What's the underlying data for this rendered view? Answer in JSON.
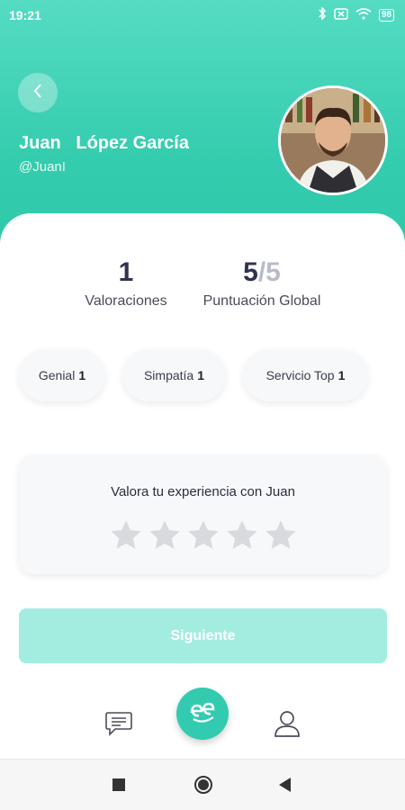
{
  "status_bar": {
    "time": "19:21",
    "battery": "98",
    "icons": [
      "bluetooth-icon",
      "sim-off-icon",
      "wifi-icon",
      "battery-icon"
    ]
  },
  "profile": {
    "first_name": "Juan",
    "last_name": "López García",
    "name_display": "Juan   López García",
    "handle": "@JuanI"
  },
  "stats": {
    "ratings_count": "1",
    "ratings_label": "Valoraciones",
    "score": "5",
    "score_max": "5",
    "score_label": "Puntuación Global"
  },
  "badges": [
    {
      "label": "Genial",
      "count": "1"
    },
    {
      "label": "Simpatía",
      "count": "1"
    },
    {
      "label": "Servicio Top",
      "count": "1"
    }
  ],
  "rating": {
    "prompt": "Valora tu experiencia con Juan",
    "stars_total": 5,
    "stars_selected": 0
  },
  "actions": {
    "next_label": "Siguiente"
  },
  "colors": {
    "accent": "#34ccae",
    "button_disabled": "#a3ede0",
    "star_empty": "#d8dade"
  },
  "nav": {
    "items": [
      "chat-icon",
      "home-logo-icon",
      "profile-icon"
    ]
  }
}
